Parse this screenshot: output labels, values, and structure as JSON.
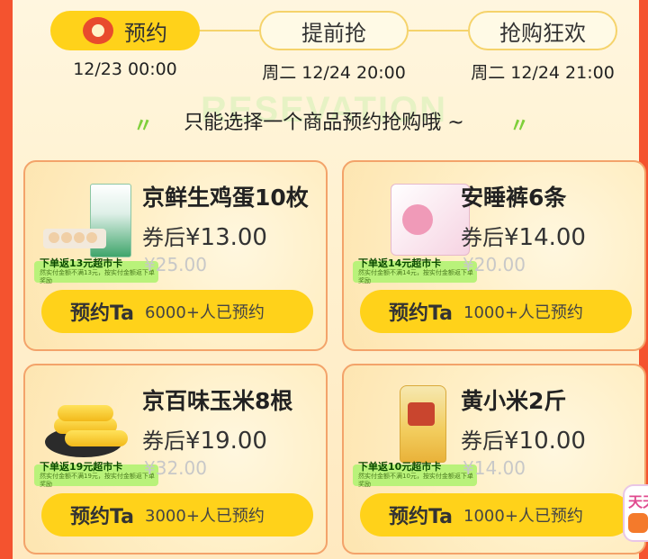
{
  "steps": [
    {
      "label": "预约",
      "date": "12/23 00:00"
    },
    {
      "label": "提前抢",
      "date": "周二 12/24 20:00"
    },
    {
      "label": "抢购狂欢",
      "date": "周二 12/24 21:00"
    }
  ],
  "watermark": "RESEVATION",
  "subtitle": "只能选择一个商品预约抢购哦 ~",
  "products": [
    {
      "name": "京鲜生鸡蛋10枚",
      "price_prefix": "券后",
      "price": "¥13.00",
      "original": "¥25.00",
      "badge_main": "下单返13元超市卡",
      "badge_sub": "然实付金额不满13元，按实付金额返下单奖励",
      "button": "预约Ta",
      "count": "6000+人已预约"
    },
    {
      "name": "安睡裤6条",
      "price_prefix": "券后",
      "price": "¥14.00",
      "original": "¥20.00",
      "badge_main": "下单返14元超市卡",
      "badge_sub": "然实付金额不满14元，按实付金额返下单奖励",
      "button": "预约Ta",
      "count": "1000+人已预约"
    },
    {
      "name": "京百味玉米8根",
      "price_prefix": "券后",
      "price": "¥19.00",
      "original": "¥32.00",
      "badge_main": "下单返19元超市卡",
      "badge_sub": "然实付金额不满19元，按实付金额返下单奖励",
      "button": "预约Ta",
      "count": "3000+人已预约"
    },
    {
      "name": "黄小米2斤",
      "price_prefix": "券后",
      "price": "¥10.00",
      "original": "¥14.00",
      "badge_main": "下单返10元超市卡",
      "badge_sub": "然实付金额不满10元，按实付金额返下单奖励",
      "button": "预约Ta",
      "count": "1000+人已预约"
    }
  ],
  "float_tag": "天天",
  "colors": {
    "accent": "#ffd21a",
    "frame": "#f4532f",
    "badge": "#b9f27a",
    "card_border": "#f3a36a"
  }
}
